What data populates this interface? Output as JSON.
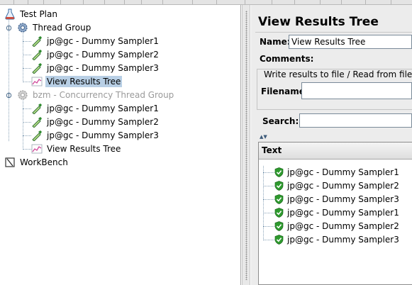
{
  "tree": {
    "test_plan": "Test Plan",
    "thread_group": "Thread Group",
    "samplers_group1": [
      "jp@gc - Dummy Sampler1",
      "jp@gc - Dummy Sampler2",
      "jp@gc - Dummy Sampler3"
    ],
    "listener_group1": "View Results Tree",
    "concurrency_group": "bzm - Concurrency Thread Group",
    "samplers_group2": [
      "jp@gc - Dummy Sampler1",
      "jp@gc - Dummy Sampler2",
      "jp@gc - Dummy Sampler3"
    ],
    "listener_group2": "View Results Tree",
    "workbench": "WorkBench"
  },
  "panel": {
    "title": "View Results Tree",
    "name_label": "Name:",
    "name_value": "View Results Tree",
    "comments_label": "Comments:",
    "file_group_title": "Write results to file / Read from file",
    "filename_label": "Filename",
    "filename_value": "",
    "search_label": "Search:",
    "search_value": "",
    "results_header": "Text",
    "results": [
      "jp@gc - Dummy Sampler1",
      "jp@gc - Dummy Sampler2",
      "jp@gc - Dummy Sampler3",
      "jp@gc - Dummy Sampler1",
      "jp@gc - Dummy Sampler2",
      "jp@gc - Dummy Sampler3"
    ]
  },
  "colors": {
    "selection": "#b8cfe5",
    "success_icon": "#2e9a2e",
    "disabled_text": "#9a9a9a"
  },
  "icons": {
    "test_plan": "flask-icon",
    "thread_group": "gear-icon",
    "sampler": "pipette-icon",
    "listener": "graph-icon",
    "workbench": "workbench-icon",
    "result_status": "shield-check-icon"
  }
}
